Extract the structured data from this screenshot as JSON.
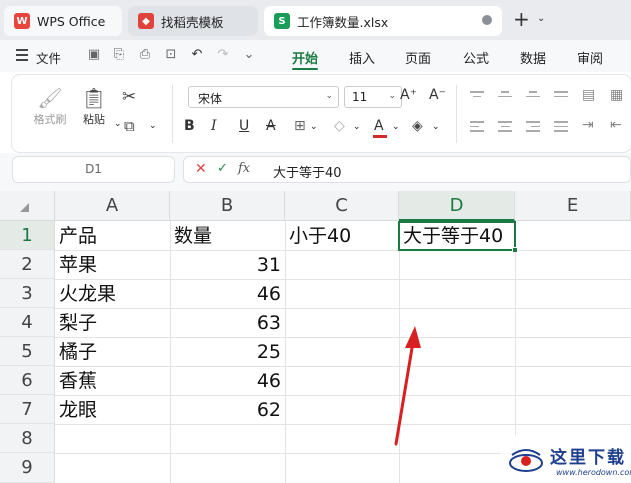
{
  "tabs": [
    {
      "label": "WPS Office",
      "icon": "wps-logo-icon"
    },
    {
      "label": "找稻壳模板",
      "icon": "docer-icon"
    },
    {
      "label": "工作簿数量.xlsx",
      "icon": "spreadsheet-icon",
      "icon_text": "S"
    }
  ],
  "menu": {
    "file_label": "文件",
    "tabs": [
      "开始",
      "插入",
      "页面",
      "公式",
      "数据",
      "审阅"
    ],
    "active_tab": "开始"
  },
  "ribbon": {
    "format_painter": "格式刷",
    "paste": "粘贴",
    "font_name": "宋体",
    "font_size": "11",
    "bold": "B",
    "italic": "I",
    "underline": "U",
    "strike": "A",
    "font_color": "#d22a2a"
  },
  "formula_bar": {
    "cell_ref": "D1",
    "fx": "fx",
    "value": "大于等于40"
  },
  "sheet": {
    "columns": [
      "A",
      "B",
      "C",
      "D",
      "E"
    ],
    "rows": [
      "1",
      "2",
      "3",
      "4",
      "5",
      "6",
      "7",
      "8",
      "9"
    ],
    "selected_column": "D",
    "selected_row": "1",
    "cells": {
      "A1": "产品",
      "B1": "数量",
      "C1": "小于40",
      "D1": "大于等于40",
      "A2": "苹果",
      "B2": "31",
      "A3": "火龙果",
      "B3": "46",
      "A4": "梨子",
      "B4": "63",
      "A5": "橘子",
      "B5": "25",
      "A6": "香蕉",
      "B6": "46",
      "A7": "龙眼",
      "B7": "62"
    }
  },
  "annotation": {
    "type": "arrow",
    "color": "#d92020"
  },
  "watermark": {
    "text": "这里下载",
    "url": "www.herodown.com"
  },
  "colors": {
    "accent": "#1b7a42",
    "wps_red": "#e8453c",
    "docer_red": "#e0433b",
    "sheet_green": "#1b9d5a"
  }
}
